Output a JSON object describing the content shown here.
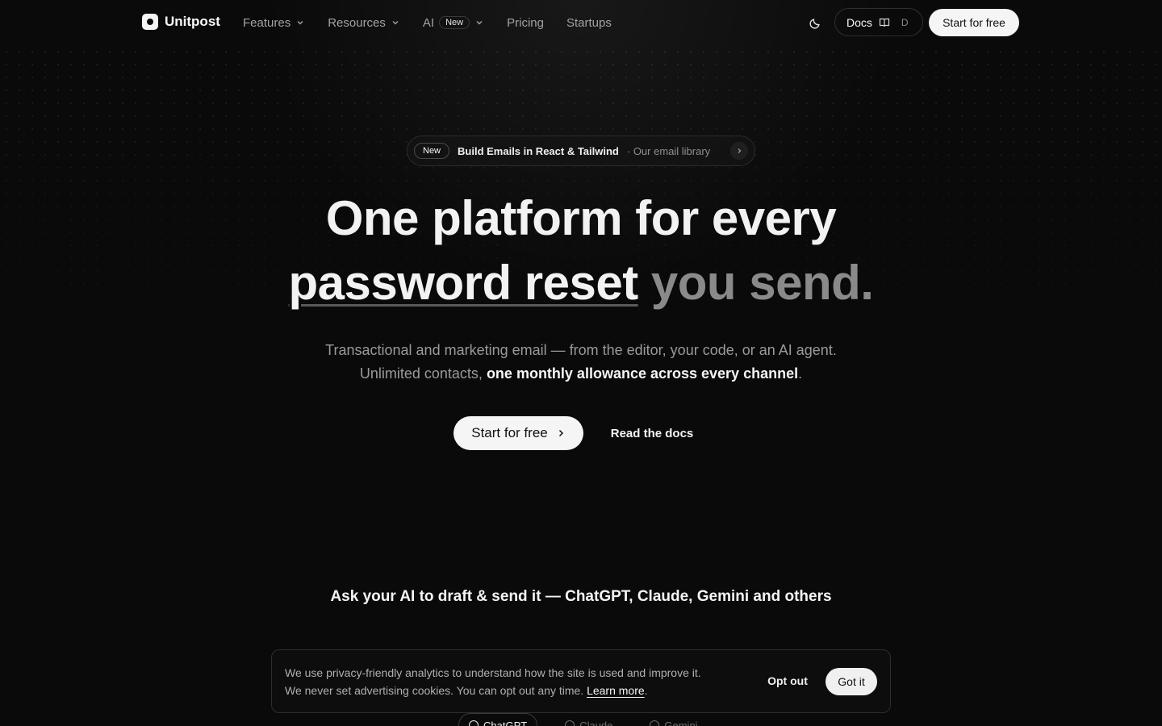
{
  "brand": {
    "name": "Unitpost"
  },
  "nav": {
    "features": "Features",
    "resources": "Resources",
    "ai": "AI",
    "ai_badge": "New",
    "pricing": "Pricing",
    "startups": "Startups",
    "docs": "Docs",
    "docs_shortcut": "D",
    "start": "Start for free"
  },
  "announce": {
    "badge": "New",
    "title": "Build Emails in React & Tailwind",
    "sub": "· Our email library"
  },
  "hero": {
    "line1": "One platform for every",
    "highlight": "password reset",
    "tail": "you send.",
    "lede1": "Transactional and marketing email — from the editor, your code, or an AI agent.",
    "lede2_pre": "Unlimited contacts, ",
    "lede2_strong": "one monthly allowance across every channel",
    "lede2_post": ".",
    "cta_primary": "Start for free",
    "cta_secondary": "Read the docs"
  },
  "ai": {
    "heading": "Ask your AI to draft & send it — ChatGPT, Claude, Gemini and others",
    "tabs": [
      "ChatGPT",
      "Claude",
      "Gemini"
    ]
  },
  "cookie": {
    "line1": "We use privacy-friendly analytics to understand how the site is used and improve it.",
    "line2": "We never set advertising cookies. You can opt out any time.",
    "learn": "Learn more",
    "period": ".",
    "optout": "Opt out",
    "gotit": "Got it"
  },
  "colors": {
    "background": "#0a0a0a",
    "primary_button": "#f5f5f5",
    "muted_text": "#9a9a9a"
  },
  "icons": [
    "logo-icon",
    "chevron-down-icon",
    "moon-icon",
    "book-icon",
    "chevron-right-icon"
  ]
}
